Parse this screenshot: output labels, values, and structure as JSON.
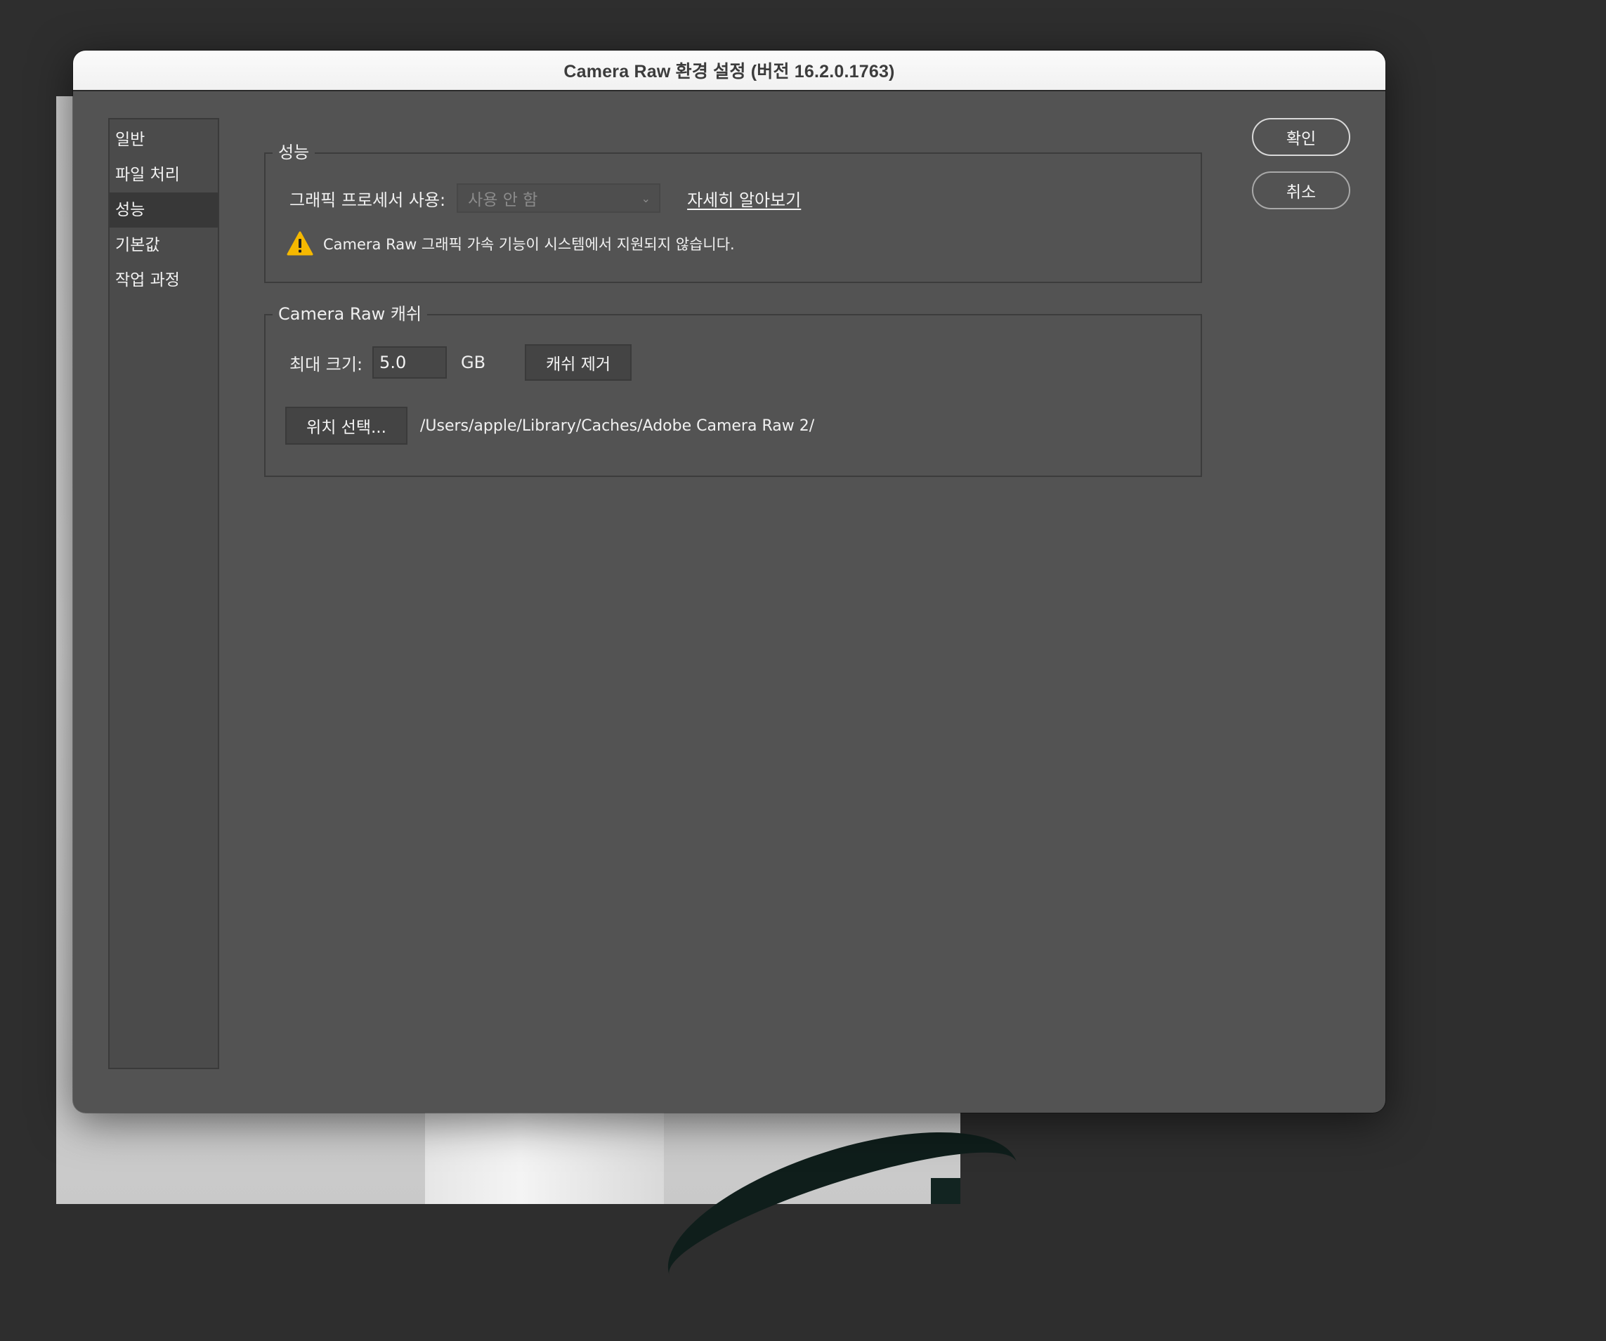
{
  "window": {
    "title": "Camera Raw 환경 설정  (버전 16.2.0.1763)"
  },
  "sidebar": {
    "items": [
      {
        "label": "일반"
      },
      {
        "label": "파일 처리"
      },
      {
        "label": "성능",
        "selected": true
      },
      {
        "label": "기본값"
      },
      {
        "label": "작업 과정"
      }
    ]
  },
  "performance": {
    "legend": "성능",
    "gpu_label": "그래픽 프로세서 사용:",
    "gpu_value": "사용 안 함",
    "learn_more": "자세히 알아보기",
    "warning": "Camera Raw 그래픽 가속 기능이 시스템에서 지원되지 않습니다.",
    "warning_icon": "warning-triangle-icon",
    "warning_color": "#f5b800"
  },
  "cache": {
    "legend": "Camera Raw 캐쉬",
    "max_size_label": "최대 크기:",
    "max_size_value": "5.0",
    "unit": "GB",
    "purge_button": "캐쉬 제거",
    "location_button": "위치 선택...",
    "path": "/Users/apple/Library/Caches/Adobe Camera Raw 2/"
  },
  "buttons": {
    "ok": "확인",
    "cancel": "취소"
  },
  "colors": {
    "dialog_bg": "#535353",
    "titlebar_bg": "#f1f1f1",
    "selected_item_bg": "#383838"
  }
}
